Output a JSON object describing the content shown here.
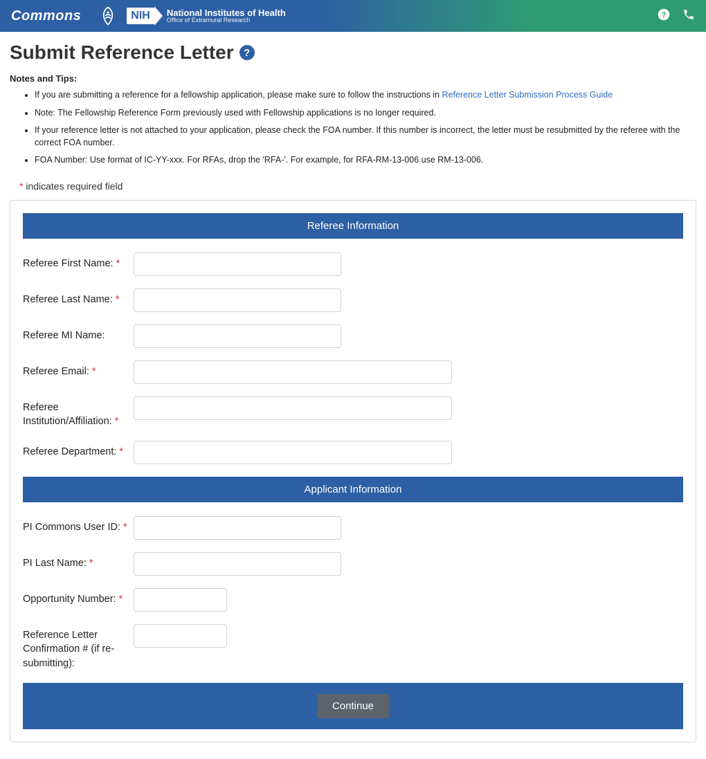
{
  "header": {
    "brand": "Commons",
    "nih_title": "National Institutes of Health",
    "nih_subtitle": "Office of Extramural Research"
  },
  "page_title": "Submit Reference Letter",
  "notes_heading": "Notes and Tips:",
  "notes": {
    "n1_prefix": "If you are submitting a reference for a fellowship application, please make sure to follow the instructions in ",
    "n1_link": "Reference Letter Submission Process Guide",
    "n2": "Note: The Fellowship Reference Form previously used with Fellowship applications is no longer required.",
    "n3": "If your reference letter is not attached to your application, please check the FOA number.  If this number is incorrect, the letter must be resubmitted by the referee with the correct FOA number.",
    "n4": "FOA Number:  Use format of IC-YY-xxx.  For RFAs, drop the 'RFA-'. For example, for RFA-RM-13-006 use RM-13-006."
  },
  "required_note_prefix": "*",
  "required_note_text": " indicates required field",
  "sections": {
    "referee": "Referee Information",
    "applicant": "Applicant Information"
  },
  "labels": {
    "ref_first": "Referee First Name:",
    "ref_last": "Referee Last Name:",
    "ref_mi": "Referee MI Name:",
    "ref_email": "Referee Email:",
    "ref_inst": "Referee Institution/Affiliation:",
    "ref_dept": "Referee Department:",
    "pi_user": "PI Commons User ID:",
    "pi_last": "PI Last Name:",
    "opp_num": "Opportunity Number:",
    "conf_num": "Reference Letter Confirmation # (if re-submitting):"
  },
  "buttons": {
    "continue": "Continue"
  }
}
